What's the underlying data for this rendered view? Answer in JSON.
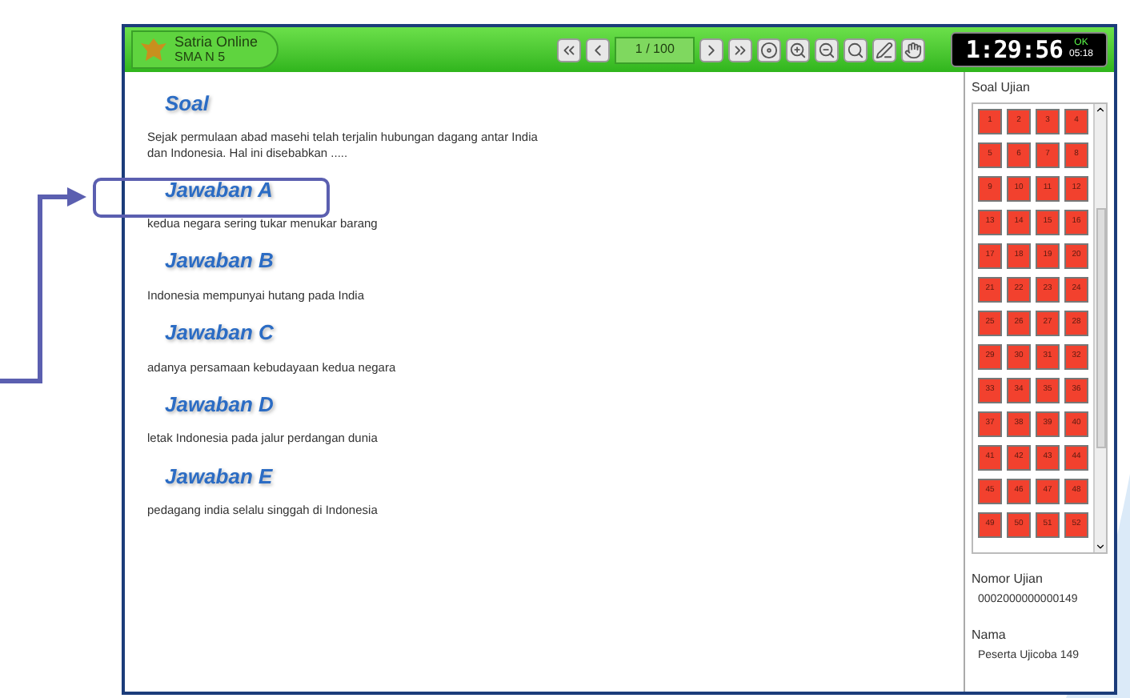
{
  "header": {
    "app_name": "Satria Online",
    "school": "SMA N 5",
    "page": "1 / 100",
    "timer": "1:29:56",
    "status": "OK",
    "time_small": "05:18"
  },
  "question": {
    "heading": "Soal",
    "text": "Sejak permulaan abad masehi telah terjalin hubungan dagang antar India dan Indonesia. Hal ini disebabkan ....."
  },
  "answers": [
    {
      "heading": "Jawaban A",
      "text": "kedua negara sering tukar menukar barang",
      "highlighted": true
    },
    {
      "heading": "Jawaban B",
      "text": "Indonesia mempunyai hutang pada India",
      "highlighted": false
    },
    {
      "heading": "Jawaban C",
      "text": "adanya persamaan kebudayaan kedua negara",
      "highlighted": false
    },
    {
      "heading": "Jawaban D",
      "text": "letak Indonesia pada jalur perdangan dunia",
      "highlighted": false
    },
    {
      "heading": "Jawaban E",
      "text": "pedagang india selalu singgah di Indonesia",
      "highlighted": false
    }
  ],
  "sidebar": {
    "title": "Soal Ujian",
    "questions": [
      "1",
      "2",
      "3",
      "4",
      "5",
      "6",
      "7",
      "8",
      "9",
      "10",
      "11",
      "12",
      "13",
      "14",
      "15",
      "16",
      "17",
      "18",
      "19",
      "20",
      "21",
      "22",
      "23",
      "24",
      "25",
      "26",
      "27",
      "28",
      "29",
      "30",
      "31",
      "32",
      "33",
      "34",
      "35",
      "36",
      "37",
      "38",
      "39",
      "40",
      "41",
      "42",
      "43",
      "44",
      "45",
      "46",
      "47",
      "48",
      "49",
      "50",
      "51",
      "52"
    ],
    "exam_number_label": "Nomor Ujian",
    "exam_number": "0002000000000149",
    "name_label": "Nama",
    "name": "Peserta Ujicoba 149"
  }
}
